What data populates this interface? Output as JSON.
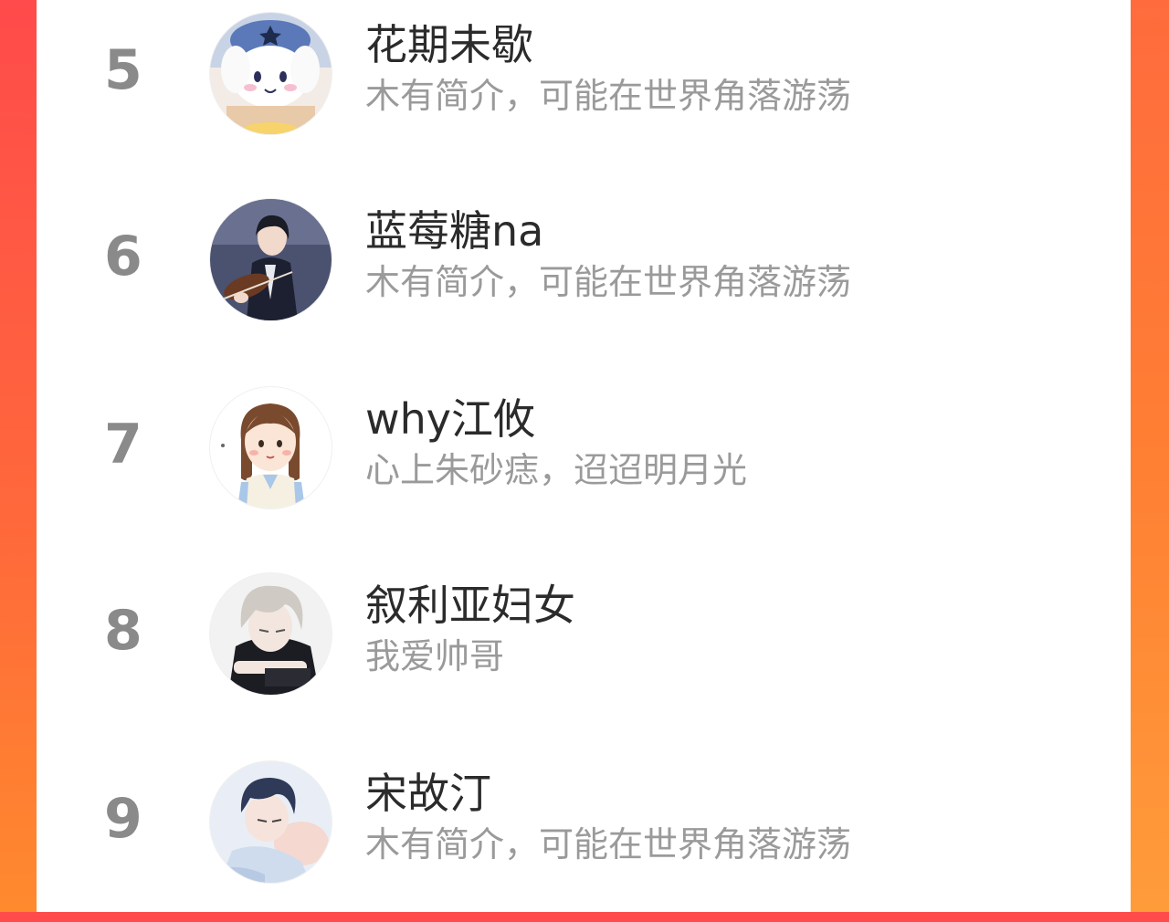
{
  "list": {
    "items": [
      {
        "rank": "5",
        "name": "花期未歇",
        "bio": "木有简介，可能在世界角落游荡",
        "avatar": "cinnamoroll-plush-avatar"
      },
      {
        "rank": "6",
        "name": "蓝莓糖na",
        "bio": "木有简介，可能在世界角落游荡",
        "avatar": "violinist-anime-avatar"
      },
      {
        "rank": "7",
        "name": "why江攸",
        "bio": "心上朱砂痣，迢迢明月光",
        "avatar": "cartoon-girl-avatar"
      },
      {
        "rank": "8",
        "name": "叙利亚妇女",
        "bio": "我爱帅哥",
        "avatar": "anime-man-avatar"
      },
      {
        "rank": "9",
        "name": "宋故汀",
        "bio": "木有简介，可能在世界角落游荡",
        "avatar": "anime-boy-avatar"
      }
    ]
  },
  "colors": {
    "background_left": "#ff4b4b",
    "background_right": "#ff8a2e",
    "panel": "#ffffff",
    "rank_text": "#8a8a8a",
    "name_text": "#2b2b2b",
    "bio_text": "#9a9a9a"
  }
}
